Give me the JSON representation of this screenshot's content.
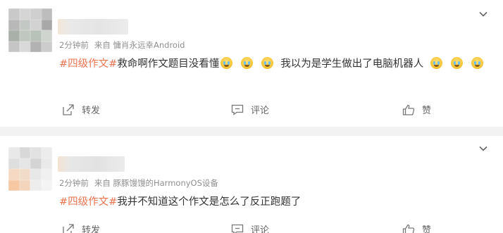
{
  "posts": [
    {
      "meta": {
        "time": "2分钟前",
        "source": "来自 慵肖永远幸Android"
      },
      "topic": "#四级作文#",
      "text_part1": "救命啊作文题目没看懂",
      "text_part2": "我以为是学生做出了电脑机器人",
      "actions": {
        "share": "转发",
        "comment": "评论",
        "like": "赞"
      }
    },
    {
      "meta": {
        "time": "2分钟前",
        "source": "来自 豚豚馒馒的HarmonyOS设备"
      },
      "topic": "#四级作文#",
      "text": "我并不知道这个作文是怎么了反正跑题了",
      "actions": {
        "share": "转发",
        "comment": "评论",
        "like": "赞"
      }
    }
  ],
  "colors": {
    "topic": "#eb7350",
    "meta": "#8f8f8f",
    "text": "#333333",
    "divider": "#f2f2f2"
  },
  "icons": [
    "chevron-down-icon",
    "share-icon",
    "comment-icon",
    "like-icon",
    "crying-laughing-emoji"
  ]
}
